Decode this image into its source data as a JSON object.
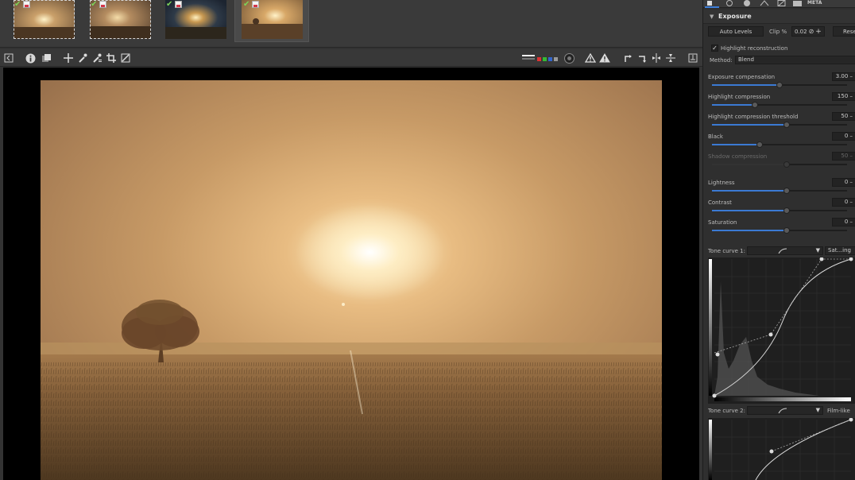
{
  "filmstrip": {
    "thumbnails": [
      {
        "name": "thumb-1",
        "selected": false,
        "has_check": true,
        "has_disk": true
      },
      {
        "name": "thumb-2",
        "selected": false,
        "has_check": true,
        "has_disk": true
      },
      {
        "name": "thumb-3",
        "selected": false,
        "has_check": true,
        "has_disk": true
      },
      {
        "name": "thumb-4",
        "selected": true,
        "has_check": true,
        "has_disk": true
      }
    ]
  },
  "toolbar": {
    "left_icons": [
      "panel-toggle-icon",
      "info-icon",
      "before-after-icon",
      "hand-icon",
      "white-balance-picker-icon",
      "color-picker-icon",
      "crop-icon",
      "straighten-icon"
    ],
    "right_icons": [
      "focus-mask-icon",
      "channel-rgb-icon",
      "preview-mode-icon",
      "clip-highlight-warning-icon",
      "clip-shadow-warning-icon",
      "rotate-left-icon",
      "rotate-right-icon",
      "flip-horizontal-icon",
      "flip-vertical-icon",
      "panel-collapse-icon"
    ]
  },
  "panel": {
    "tabs_meta_label": "META",
    "section_title": "Exposure",
    "auto_levels_label": "Auto Levels",
    "clip_label": "Clip %",
    "clip_value": "0.02",
    "reset_label": "Rese",
    "highlight_reconstruction_label": "Highlight reconstruction",
    "highlight_reconstruction_checked": true,
    "method_label": "Method:",
    "method_value": "Blend",
    "sliders": [
      {
        "label": "Exposure compensation",
        "value": "3.00",
        "fraction": 0.5,
        "dim": false
      },
      {
        "label": "Highlight compression",
        "value": "150",
        "fraction": 0.32,
        "dim": false
      },
      {
        "label": "Highlight compression threshold",
        "value": "50",
        "fraction": 0.55,
        "dim": false
      },
      {
        "label": "Black",
        "value": "0",
        "fraction": 0.35,
        "dim": false
      },
      {
        "label": "Shadow compression",
        "value": "50",
        "fraction": 0.55,
        "dim": true
      },
      {
        "label": "Lightness",
        "value": "0",
        "fraction": 0.55,
        "dim": false
      },
      {
        "label": "Contrast",
        "value": "0",
        "fraction": 0.55,
        "dim": false
      },
      {
        "label": "Saturation",
        "value": "0",
        "fraction": 0.55,
        "dim": false
      }
    ],
    "tone_curve_1_label": "Tone curve 1:",
    "tone_curve_1_mode": "Sat...ing",
    "tone_curve_2_label": "Tone curve 2:",
    "tone_curve_2_mode": "Film-like"
  },
  "colors": {
    "accent": "#3b7ad3",
    "check_green": "#7cd35a"
  }
}
